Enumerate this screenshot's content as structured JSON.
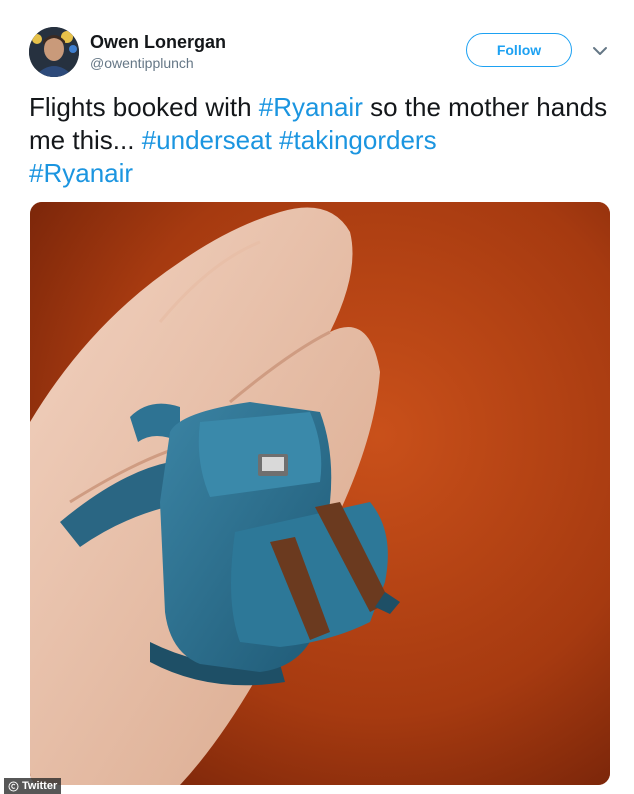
{
  "tweet": {
    "author": {
      "name": "Owen Lonergan",
      "handle": "@owentipplunch"
    },
    "follow_label": "Follow",
    "menu_icon": "chevron-down-icon",
    "text": {
      "line1_a": "Flights booked with ",
      "tag1": "#Ryanair",
      "line1_b": " so the mother hands me this... ",
      "tag2": "#underseat",
      "space": " ",
      "tag3": "#takingorders",
      "tag4": "#Ryanair"
    },
    "media_description_icon": "photo",
    "watermark": "Twitter"
  },
  "colors": {
    "link": "#1b95e0",
    "follow_border": "#1da1f2",
    "text": "#14171a",
    "muted": "#657786",
    "photo_background": "#a8350e",
    "backpack": "#2f6f8c"
  }
}
